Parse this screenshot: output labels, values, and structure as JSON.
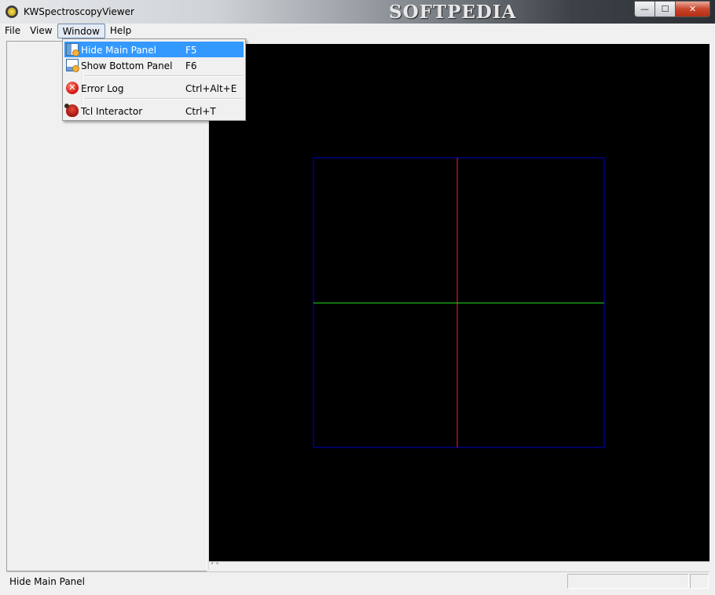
{
  "window": {
    "title": "KWSpectroscopyViewer",
    "watermark": "SOFTPEDIA",
    "controls": {
      "minimize": "—",
      "maximize": "☐",
      "close": "✕"
    }
  },
  "menubar": {
    "items": [
      {
        "label": "File"
      },
      {
        "label": "View"
      },
      {
        "label": "Window"
      },
      {
        "label": "Help"
      }
    ]
  },
  "window_menu": {
    "items": [
      {
        "label": "Hide Main Panel",
        "shortcut": "F5",
        "icon": "panel-icon",
        "highlighted": true
      },
      {
        "label": "Show Bottom Panel",
        "shortcut": "F6",
        "icon": "bottom-panel-icon"
      },
      {
        "label": "Error Log",
        "shortcut": "Ctrl+Alt+E",
        "icon": "error-icon"
      },
      {
        "label": "Tcl Interactor",
        "shortcut": "Ctrl+T",
        "icon": "ladybug-icon"
      }
    ]
  },
  "bottom_splitter": {
    "arrows": "˅ ˄"
  },
  "statusbar": {
    "text": "Hide Main Panel"
  },
  "colors": {
    "viewport_bg": "#000000",
    "outline": "#0000cc",
    "vertical_axis": "#ff2020",
    "horizontal_axis": "#20e020",
    "menu_highlight": "#3399ff"
  }
}
